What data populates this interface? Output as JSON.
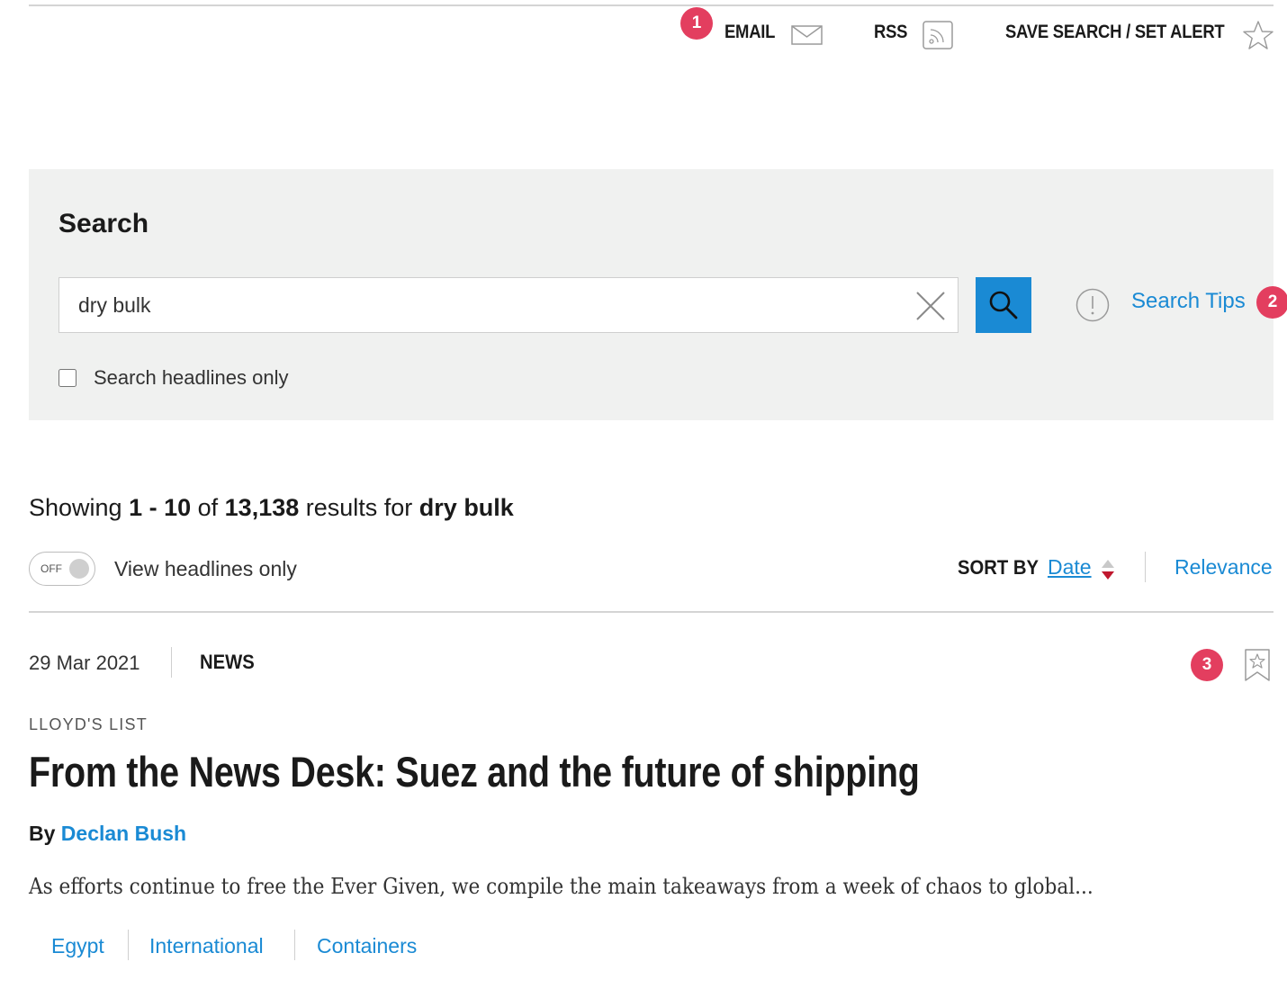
{
  "annotations": {
    "badge_1": "1",
    "badge_2": "2",
    "badge_3": "3",
    "badge_color": "#e33e5f"
  },
  "utility_bar": {
    "email_label": "EMAIL",
    "email_icon": "envelope-icon",
    "rss_label": "RSS",
    "rss_icon": "rss-icon",
    "save_search_label": "SAVE SEARCH / SET ALERT",
    "save_search_icon": "star-icon"
  },
  "search": {
    "heading": "Search",
    "query": "dry bulk",
    "clear_icon": "close-icon",
    "submit_icon": "search-icon",
    "tips_icon": "info-icon",
    "tips_label": "Search Tips",
    "headlines_only_label": "Search headlines only",
    "headlines_only_checked": false,
    "accent_color": "#1a8ad4"
  },
  "results": {
    "prefix": "Showing ",
    "range": "1 - 10",
    "of_text": " of ",
    "total": "13,138",
    "for_text": " results for ",
    "term": "dry bulk",
    "toggle_state": "OFF",
    "toggle_label": "View headlines only",
    "sort_by_label": "SORT BY",
    "sort_options": [
      "Date",
      "Relevance"
    ],
    "sort_selected": "Date"
  },
  "articles": [
    {
      "date": "29 Mar 2021",
      "type": "NEWS",
      "publication": "LLOYD'S LIST",
      "headline": "From the News Desk: Suez and the future of shipping",
      "byline_prefix": "By ",
      "author": "Declan Bush",
      "summary": "As efforts continue to free the Ever Given, we compile the main takeaways from a week of chaos to global...",
      "tags": [
        "Egypt",
        "International",
        "Containers"
      ],
      "bookmark_icon": "bookmark-icon"
    }
  ]
}
